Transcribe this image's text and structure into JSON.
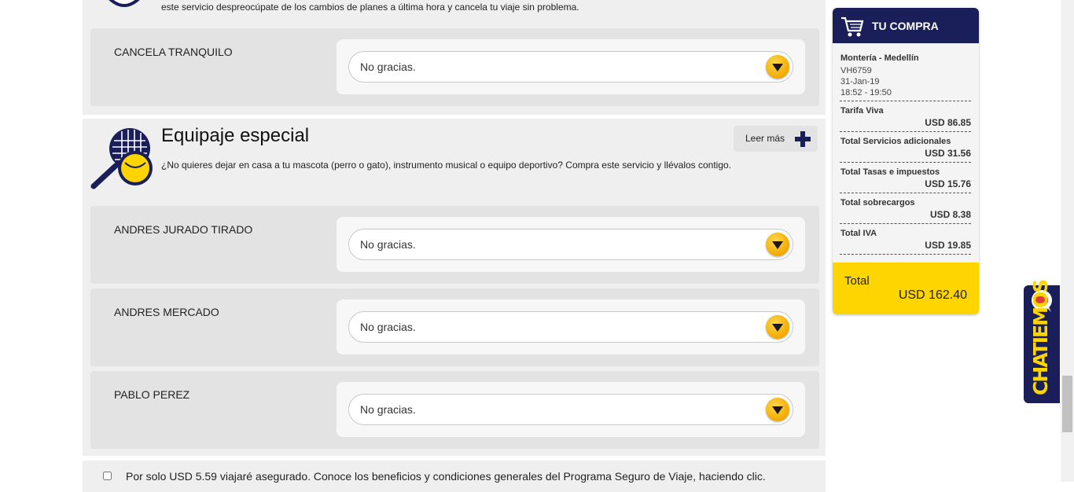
{
  "top_section": {
    "description": "este servicio despreocúpate de los cambios de planes a última hora y cancela tu viaje sin problema.",
    "row": {
      "name": "CANCELA TRANQUILO",
      "select_value": "No gracias."
    }
  },
  "equipaje": {
    "title": "Equipaje especial",
    "description": "¿No quieres dejar en casa a tu mascota (perro o gato), instrumento musical o equipo deportivo? Compra este servicio y llévalos contigo.",
    "read_more": "Leer más",
    "rows": [
      {
        "name": "ANDRES JURADO TIRADO",
        "select_value": "No gracias."
      },
      {
        "name": "ANDRES MERCADO",
        "select_value": "No gracias."
      },
      {
        "name": "PABLO PEREZ",
        "select_value": "No gracias."
      }
    ]
  },
  "insurance": {
    "text": "Por solo USD 5.59 viajaré asegurado. Conoce los beneficios y condiciones generales del Programa Seguro de Viaje, haciendo clic."
  },
  "cart": {
    "title": "TU COMPRA",
    "route": "Montería - Medellín",
    "flight": "VH6759",
    "date": "31-Jan-19",
    "time": "18:52 - 19:50",
    "lines": [
      {
        "label": "Tarifa Viva",
        "value": "USD 86.85"
      },
      {
        "label": "Total Servicios adicionales",
        "value": "USD 31.56"
      },
      {
        "label": "Total Tasas e impuestos",
        "value": "USD 15.76"
      },
      {
        "label": "Total sobrecargos",
        "value": "USD 8.38"
      },
      {
        "label": "Total IVA",
        "value": "USD 19.85"
      }
    ],
    "total_label": "Total",
    "total_value": "USD 162.40"
  },
  "chat": {
    "label": "CHATIEMOS"
  },
  "colors": {
    "navy": "#1a1f5a",
    "yellow": "#ffd500",
    "panel": "#efefef"
  },
  "icons": [
    "shield-icon",
    "tennis-racket-icon",
    "plus-icon",
    "cart-icon",
    "chevron-down-icon",
    "chat-bubble-icon"
  ]
}
